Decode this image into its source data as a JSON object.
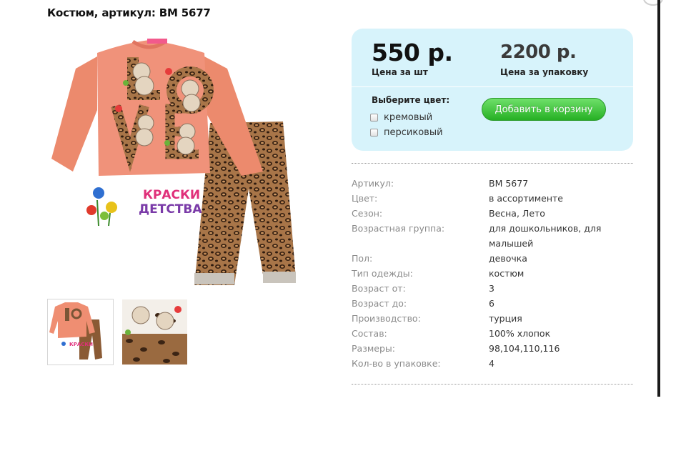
{
  "product": {
    "title": "Костюм, артикул: BM 5677"
  },
  "gallery": {
    "main_image": "product-photo-suit-love-print",
    "brand_logo_text": "Краски Детства",
    "thumbnails": [
      "thumbnail-front",
      "thumbnail-detail"
    ]
  },
  "pricing": {
    "unit_price": "550 р.",
    "unit_label": "Цена за шт",
    "pack_price": "2200 р.",
    "pack_label": "Цена за упаковку",
    "color_heading": "Выберите цвет:",
    "color_options": [
      "кремовый",
      "персиковый"
    ],
    "add_to_cart_label": "Добавить в корзину"
  },
  "specs": [
    {
      "key": "Артикул:",
      "value": "BM 5677"
    },
    {
      "key": "Цвет:",
      "value": "в ассортименте"
    },
    {
      "key": "Сезон:",
      "value": "Весна, Лето"
    },
    {
      "key": "Возрастная группа:",
      "value": "для дошкольников, для малышей"
    },
    {
      "key": "Пол:",
      "value": "девочка"
    },
    {
      "key": "Тип одежды:",
      "value": "костюм"
    },
    {
      "key": "Возраст от:",
      "value": "3"
    },
    {
      "key": "Возраст до:",
      "value": "6"
    },
    {
      "key": "Производство:",
      "value": "турция"
    },
    {
      "key": "Состав:",
      "value": "100% хлопок"
    },
    {
      "key": "Размеры:",
      "value": "98,104,110,116"
    },
    {
      "key": "Кол-во в упаковке:",
      "value": "4"
    }
  ],
  "colors": {
    "price_box_bg": "#d7f3fb",
    "button_green": "#26b024",
    "shirt_peach": "#ef8e72",
    "leopard_base": "#9a6a40"
  }
}
